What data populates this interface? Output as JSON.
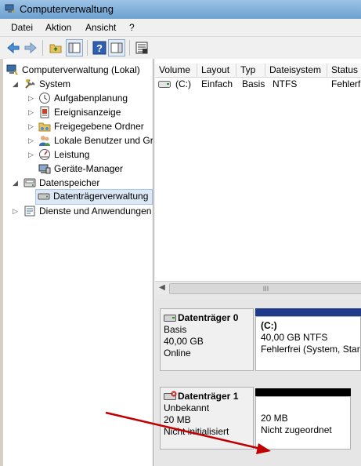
{
  "window": {
    "title": "Computerverwaltung"
  },
  "menu": {
    "items": [
      "Datei",
      "Aktion",
      "Ansicht",
      "?"
    ]
  },
  "tree": {
    "root": "Computerverwaltung (Lokal)",
    "system": "System",
    "system_children": [
      "Aufgabenplanung",
      "Ereignisanzeige",
      "Freigegebene Ordner",
      "Lokale Benutzer und Gru",
      "Leistung",
      "Geräte-Manager"
    ],
    "storage": "Datenspeicher",
    "storage_children": [
      "Datenträgerverwaltung"
    ],
    "services": "Dienste und Anwendungen"
  },
  "volume_table": {
    "columns": [
      "Volume",
      "Layout",
      "Typ",
      "Dateisystem",
      "Status"
    ],
    "rows": [
      {
        "volume": "(C:)",
        "layout": "Einfach",
        "typ": "Basis",
        "dateisystem": "NTFS",
        "status": "Fehlerf"
      }
    ],
    "scroll_grip": "III"
  },
  "disks": [
    {
      "name": "Datenträger 0",
      "type": "Basis",
      "size": "40,00 GB",
      "state": "Online",
      "partition": {
        "name": "(C:)",
        "size_fs": "40,00 GB NTFS",
        "status": "Fehlerfrei (System, Startp"
      }
    },
    {
      "name": "Datenträger 1",
      "type": "Unbekannt",
      "size": "20 MB",
      "state": "Nicht initialisiert",
      "partition": {
        "size": "20 MB",
        "status": "Nicht zugeordnet"
      }
    }
  ],
  "colors": {
    "titlebar": "#8fb8df",
    "primary_partition_bar": "#1f3a8a",
    "unallocated_bar": "#000000",
    "annotation_arrow": "#c00000",
    "selection": "#dce8f6"
  }
}
